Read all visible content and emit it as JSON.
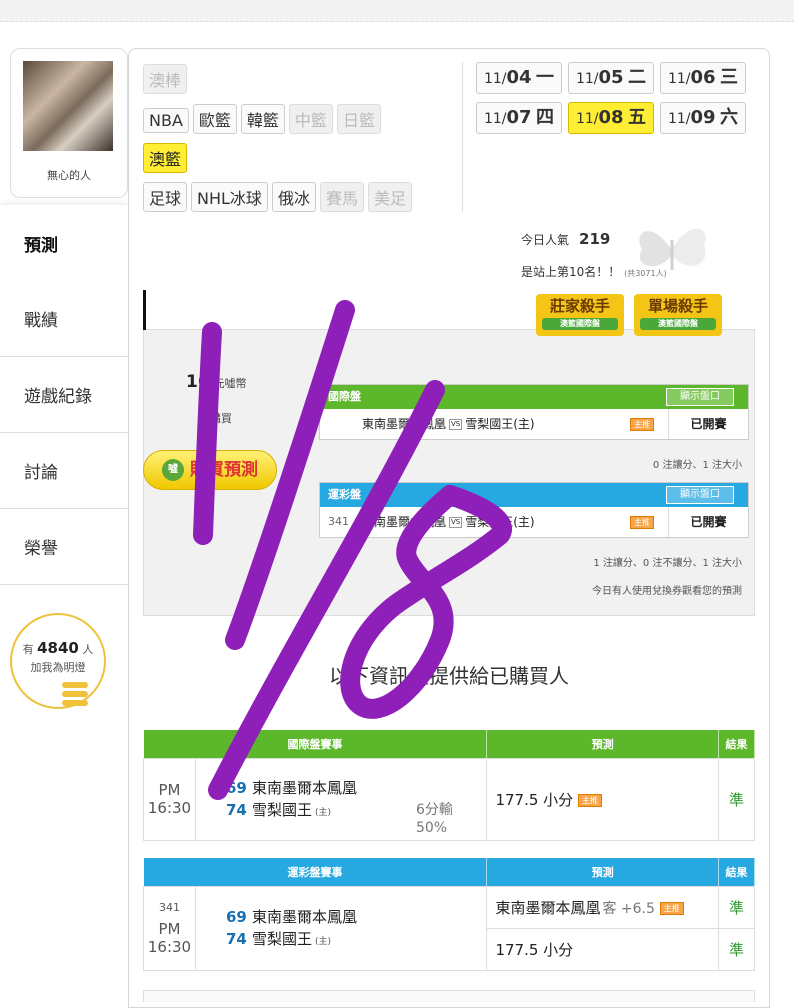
{
  "user": {
    "name": "無心的人"
  },
  "sidebar": {
    "items": [
      {
        "label": "預測",
        "active": true
      },
      {
        "label": "戰績"
      },
      {
        "label": "遊戲紀錄"
      },
      {
        "label": "討論"
      },
      {
        "label": "榮譽"
      }
    ]
  },
  "lightbulb": {
    "prefix": "有",
    "count": "4840",
    "suffix": "人",
    "line2": "加我為明燈"
  },
  "sports": {
    "row0": [
      {
        "label": "澳棒",
        "state": "dim"
      }
    ],
    "row1": [
      {
        "label": "NBA"
      },
      {
        "label": "歐籃"
      },
      {
        "label": "韓籃"
      },
      {
        "label": "中籃",
        "state": "dim"
      },
      {
        "label": "日籃",
        "state": "dim"
      }
    ],
    "row2": [
      {
        "label": "澳籃",
        "state": "sel"
      }
    ],
    "row3": [
      {
        "label": "足球"
      },
      {
        "label": "NHL冰球"
      },
      {
        "label": "俄冰"
      },
      {
        "label": "賽馬",
        "state": "dim"
      },
      {
        "label": "美足",
        "state": "dim"
      }
    ]
  },
  "dates": [
    {
      "md": "11/",
      "d": "04",
      "w": "一"
    },
    {
      "md": "11/",
      "d": "05",
      "w": "二"
    },
    {
      "md": "11/",
      "d": "06",
      "w": "三"
    },
    {
      "md": "11/",
      "d": "07",
      "w": "四"
    },
    {
      "md": "11/",
      "d": "08",
      "w": "五",
      "sel": true
    },
    {
      "md": "11/",
      "d": "09",
      "w": "六"
    }
  ],
  "stats": {
    "popularity_label": "今日人氣",
    "popularity": "219",
    "rank_text": "是站上第10名！！",
    "rank_total": "(共3071人)"
  },
  "badges": [
    {
      "title": "莊家殺手",
      "sub": "澳籃國際盤"
    },
    {
      "title": "單場殺手",
      "sub": "澳籃國際盤"
    }
  ],
  "purchase": {
    "coins": "16",
    "coins_unit": "元噓幣",
    "bought": "購買",
    "buy_label": "購買預測",
    "buy_icon": "噓"
  },
  "intl": {
    "title": "國際盤",
    "show_btn": "顯示盤口",
    "row": {
      "num": "",
      "away": "東南墨爾本鳳凰",
      "vs": "VS",
      "home": "雪梨國王(主)",
      "tag": "主推",
      "status": "已開賽"
    },
    "note": "0 注讓分、1 注大小"
  },
  "lottery": {
    "title": "運彩盤",
    "show_btn": "顯示盤口",
    "row": {
      "num": "341",
      "away": "東南墨爾本鳳凰",
      "vs": "VS",
      "home": "雪梨國王(主)",
      "tag": "主推",
      "status": "已開賽"
    },
    "note": "1 注讓分、0 注不讓分、1 注大小",
    "note2": "今日有人使用兌換券觀看您的預測"
  },
  "notice": "以下資訊僅提供給已購買人",
  "result_intl": {
    "headers": [
      "國際盤賽事",
      "預測",
      "結果"
    ],
    "time": "PM 16:30",
    "team1_score": "69",
    "team1": "東南墨爾本鳳凰",
    "team2_score": "74",
    "team2": "雪梨國王",
    "host": "(主)",
    "loss": "6分輸",
    "loss_pct": "50%",
    "prediction": "177.5 小分",
    "tag": "主推",
    "result": "準"
  },
  "result_lottery": {
    "headers": [
      "運彩盤賽事",
      "預測",
      "結果"
    ],
    "game_no": "341",
    "time": "PM 16:30",
    "team1_score": "69",
    "team1": "東南墨爾本鳳凰",
    "team2_score": "74",
    "team2": "雪梨國王",
    "host": "(主)",
    "pred1": "東南墨爾本鳳凰",
    "pred1_ke": "客 +6.5",
    "tag": "主推",
    "result1": "準",
    "pred2": "177.5 小分",
    "result2": "準"
  },
  "overlay_text": "1/8",
  "colors": {
    "green": "#5cb82a",
    "blue": "#26a9e0",
    "yellow": "#ffee33",
    "ink": "#8e1fb8"
  }
}
